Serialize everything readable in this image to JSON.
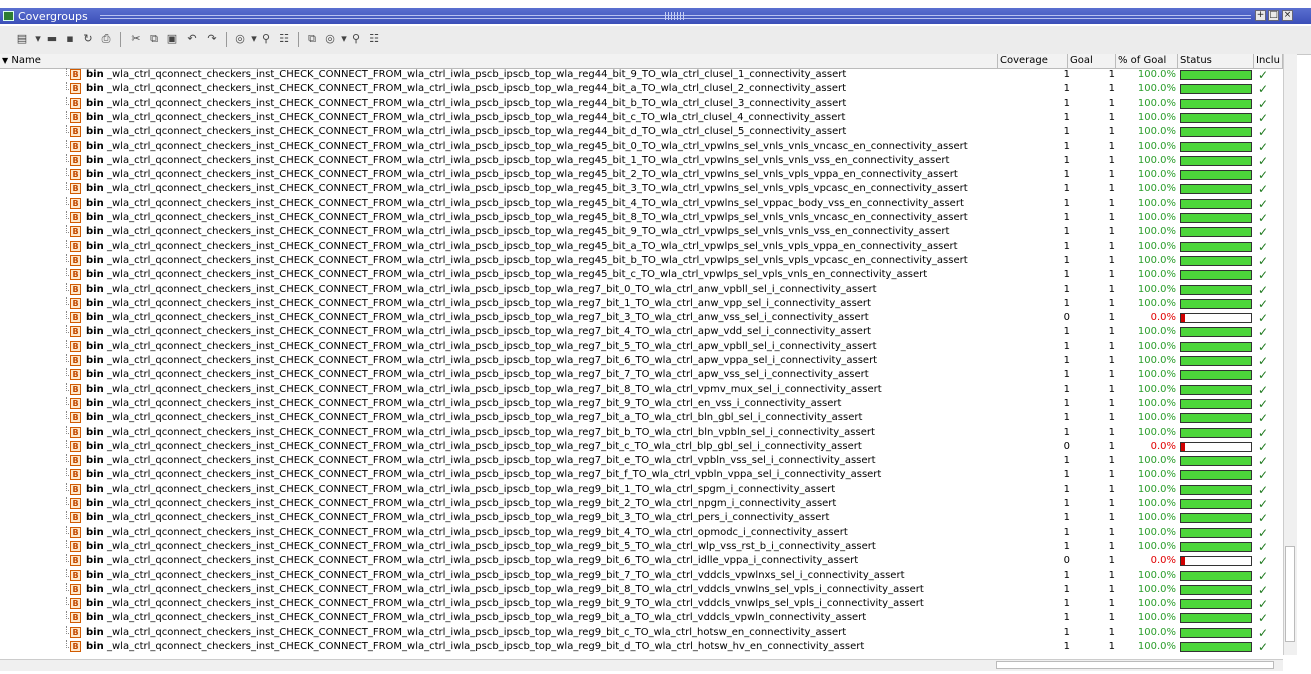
{
  "window": {
    "title": "Covergroups"
  },
  "columns": {
    "name": "Name",
    "coverage": "Coverage",
    "goal": "Goal",
    "pct_goal": "% of Goal",
    "status": "Status",
    "included": "Inclu"
  },
  "rows": [
    {
      "type": "bin",
      "name": "_wla_ctrl_qconnect_checkers_inst_CHECK_CONNECT_FROM_wla_ctrl_iwla_pscb_ipscb_top_wla_reg44_bit_9_TO_wla_ctrl_clusel_1_connectivity_assert",
      "coverage": "1",
      "goal": "1",
      "pct": "100.0%",
      "fill": 1
    },
    {
      "type": "bin",
      "name": "_wla_ctrl_qconnect_checkers_inst_CHECK_CONNECT_FROM_wla_ctrl_iwla_pscb_ipscb_top_wla_reg44_bit_a_TO_wla_ctrl_clusel_2_connectivity_assert",
      "coverage": "1",
      "goal": "1",
      "pct": "100.0%",
      "fill": 1
    },
    {
      "type": "bin",
      "name": "_wla_ctrl_qconnect_checkers_inst_CHECK_CONNECT_FROM_wla_ctrl_iwla_pscb_ipscb_top_wla_reg44_bit_b_TO_wla_ctrl_clusel_3_connectivity_assert",
      "coverage": "1",
      "goal": "1",
      "pct": "100.0%",
      "fill": 1
    },
    {
      "type": "bin",
      "name": "_wla_ctrl_qconnect_checkers_inst_CHECK_CONNECT_FROM_wla_ctrl_iwla_pscb_ipscb_top_wla_reg44_bit_c_TO_wla_ctrl_clusel_4_connectivity_assert",
      "coverage": "1",
      "goal": "1",
      "pct": "100.0%",
      "fill": 1
    },
    {
      "type": "bin",
      "name": "_wla_ctrl_qconnect_checkers_inst_CHECK_CONNECT_FROM_wla_ctrl_iwla_pscb_ipscb_top_wla_reg44_bit_d_TO_wla_ctrl_clusel_5_connectivity_assert",
      "coverage": "1",
      "goal": "1",
      "pct": "100.0%",
      "fill": 1
    },
    {
      "type": "bin",
      "name": "_wla_ctrl_qconnect_checkers_inst_CHECK_CONNECT_FROM_wla_ctrl_iwla_pscb_ipscb_top_wla_reg45_bit_0_TO_wla_ctrl_vpwlns_sel_vnls_vnls_vncasc_en_connectivity_assert",
      "coverage": "1",
      "goal": "1",
      "pct": "100.0%",
      "fill": 1
    },
    {
      "type": "bin",
      "name": "_wla_ctrl_qconnect_checkers_inst_CHECK_CONNECT_FROM_wla_ctrl_iwla_pscb_ipscb_top_wla_reg45_bit_1_TO_wla_ctrl_vpwlns_sel_vnls_vnls_vss_en_connectivity_assert",
      "coverage": "1",
      "goal": "1",
      "pct": "100.0%",
      "fill": 1
    },
    {
      "type": "bin",
      "name": "_wla_ctrl_qconnect_checkers_inst_CHECK_CONNECT_FROM_wla_ctrl_iwla_pscb_ipscb_top_wla_reg45_bit_2_TO_wla_ctrl_vpwlns_sel_vnls_vpls_vppa_en_connectivity_assert",
      "coverage": "1",
      "goal": "1",
      "pct": "100.0%",
      "fill": 1
    },
    {
      "type": "bin",
      "name": "_wla_ctrl_qconnect_checkers_inst_CHECK_CONNECT_FROM_wla_ctrl_iwla_pscb_ipscb_top_wla_reg45_bit_3_TO_wla_ctrl_vpwlns_sel_vnls_vpls_vpcasc_en_connectivity_assert",
      "coverage": "1",
      "goal": "1",
      "pct": "100.0%",
      "fill": 1
    },
    {
      "type": "bin",
      "name": "_wla_ctrl_qconnect_checkers_inst_CHECK_CONNECT_FROM_wla_ctrl_iwla_pscb_ipscb_top_wla_reg45_bit_4_TO_wla_ctrl_vpwlns_sel_vppac_body_vss_en_connectivity_assert",
      "coverage": "1",
      "goal": "1",
      "pct": "100.0%",
      "fill": 1
    },
    {
      "type": "bin",
      "name": "_wla_ctrl_qconnect_checkers_inst_CHECK_CONNECT_FROM_wla_ctrl_iwla_pscb_ipscb_top_wla_reg45_bit_8_TO_wla_ctrl_vpwlps_sel_vnls_vnls_vncasc_en_connectivity_assert",
      "coverage": "1",
      "goal": "1",
      "pct": "100.0%",
      "fill": 1
    },
    {
      "type": "bin",
      "name": "_wla_ctrl_qconnect_checkers_inst_CHECK_CONNECT_FROM_wla_ctrl_iwla_pscb_ipscb_top_wla_reg45_bit_9_TO_wla_ctrl_vpwlps_sel_vnls_vnls_vss_en_connectivity_assert",
      "coverage": "1",
      "goal": "1",
      "pct": "100.0%",
      "fill": 1
    },
    {
      "type": "bin",
      "name": "_wla_ctrl_qconnect_checkers_inst_CHECK_CONNECT_FROM_wla_ctrl_iwla_pscb_ipscb_top_wla_reg45_bit_a_TO_wla_ctrl_vpwlps_sel_vnls_vpls_vppa_en_connectivity_assert",
      "coverage": "1",
      "goal": "1",
      "pct": "100.0%",
      "fill": 1
    },
    {
      "type": "bin",
      "name": "_wla_ctrl_qconnect_checkers_inst_CHECK_CONNECT_FROM_wla_ctrl_iwla_pscb_ipscb_top_wla_reg45_bit_b_TO_wla_ctrl_vpwlps_sel_vnls_vpls_vpcasc_en_connectivity_assert",
      "coverage": "1",
      "goal": "1",
      "pct": "100.0%",
      "fill": 1
    },
    {
      "type": "bin",
      "name": "_wla_ctrl_qconnect_checkers_inst_CHECK_CONNECT_FROM_wla_ctrl_iwla_pscb_ipscb_top_wla_reg45_bit_c_TO_wla_ctrl_vpwlps_sel_vpls_vnls_en_connectivity_assert",
      "coverage": "1",
      "goal": "1",
      "pct": "100.0%",
      "fill": 1
    },
    {
      "type": "bin",
      "name": "_wla_ctrl_qconnect_checkers_inst_CHECK_CONNECT_FROM_wla_ctrl_iwla_pscb_ipscb_top_wla_reg7_bit_0_TO_wla_ctrl_anw_vpbll_sel_i_connectivity_assert",
      "coverage": "1",
      "goal": "1",
      "pct": "100.0%",
      "fill": 1
    },
    {
      "type": "bin",
      "name": "_wla_ctrl_qconnect_checkers_inst_CHECK_CONNECT_FROM_wla_ctrl_iwla_pscb_ipscb_top_wla_reg7_bit_1_TO_wla_ctrl_anw_vpp_sel_i_connectivity_assert",
      "coverage": "1",
      "goal": "1",
      "pct": "100.0%",
      "fill": 1
    },
    {
      "type": "bin",
      "name": "_wla_ctrl_qconnect_checkers_inst_CHECK_CONNECT_FROM_wla_ctrl_iwla_pscb_ipscb_top_wla_reg7_bit_3_TO_wla_ctrl_anw_vss_sel_i_connectivity_assert",
      "coverage": "0",
      "goal": "1",
      "pct": "0.0%",
      "fill": 0
    },
    {
      "type": "bin",
      "name": "_wla_ctrl_qconnect_checkers_inst_CHECK_CONNECT_FROM_wla_ctrl_iwla_pscb_ipscb_top_wla_reg7_bit_4_TO_wla_ctrl_apw_vdd_sel_i_connectivity_assert",
      "coverage": "1",
      "goal": "1",
      "pct": "100.0%",
      "fill": 1
    },
    {
      "type": "bin",
      "name": "_wla_ctrl_qconnect_checkers_inst_CHECK_CONNECT_FROM_wla_ctrl_iwla_pscb_ipscb_top_wla_reg7_bit_5_TO_wla_ctrl_apw_vpbll_sel_i_connectivity_assert",
      "coverage": "1",
      "goal": "1",
      "pct": "100.0%",
      "fill": 1
    },
    {
      "type": "bin",
      "name": "_wla_ctrl_qconnect_checkers_inst_CHECK_CONNECT_FROM_wla_ctrl_iwla_pscb_ipscb_top_wla_reg7_bit_6_TO_wla_ctrl_apw_vppa_sel_i_connectivity_assert",
      "coverage": "1",
      "goal": "1",
      "pct": "100.0%",
      "fill": 1
    },
    {
      "type": "bin",
      "name": "_wla_ctrl_qconnect_checkers_inst_CHECK_CONNECT_FROM_wla_ctrl_iwla_pscb_ipscb_top_wla_reg7_bit_7_TO_wla_ctrl_apw_vss_sel_i_connectivity_assert",
      "coverage": "1",
      "goal": "1",
      "pct": "100.0%",
      "fill": 1
    },
    {
      "type": "bin",
      "name": "_wla_ctrl_qconnect_checkers_inst_CHECK_CONNECT_FROM_wla_ctrl_iwla_pscb_ipscb_top_wla_reg7_bit_8_TO_wla_ctrl_vpmv_mux_sel_i_connectivity_assert",
      "coverage": "1",
      "goal": "1",
      "pct": "100.0%",
      "fill": 1
    },
    {
      "type": "bin",
      "name": "_wla_ctrl_qconnect_checkers_inst_CHECK_CONNECT_FROM_wla_ctrl_iwla_pscb_ipscb_top_wla_reg7_bit_9_TO_wla_ctrl_en_vss_i_connectivity_assert",
      "coverage": "1",
      "goal": "1",
      "pct": "100.0%",
      "fill": 1
    },
    {
      "type": "bin",
      "name": "_wla_ctrl_qconnect_checkers_inst_CHECK_CONNECT_FROM_wla_ctrl_iwla_pscb_ipscb_top_wla_reg7_bit_a_TO_wla_ctrl_bln_gbl_sel_i_connectivity_assert",
      "coverage": "1",
      "goal": "1",
      "pct": "100.0%",
      "fill": 1
    },
    {
      "type": "bin",
      "name": "_wla_ctrl_qconnect_checkers_inst_CHECK_CONNECT_FROM_wla_ctrl_iwla_pscb_ipscb_top_wla_reg7_bit_b_TO_wla_ctrl_bln_vpbln_sel_i_connectivity_assert",
      "coverage": "1",
      "goal": "1",
      "pct": "100.0%",
      "fill": 1
    },
    {
      "type": "bin",
      "name": "_wla_ctrl_qconnect_checkers_inst_CHECK_CONNECT_FROM_wla_ctrl_iwla_pscb_ipscb_top_wla_reg7_bit_c_TO_wla_ctrl_blp_gbl_sel_i_connectivity_assert",
      "coverage": "0",
      "goal": "1",
      "pct": "0.0%",
      "fill": 0
    },
    {
      "type": "bin",
      "name": "_wla_ctrl_qconnect_checkers_inst_CHECK_CONNECT_FROM_wla_ctrl_iwla_pscb_ipscb_top_wla_reg7_bit_e_TO_wla_ctrl_vpbln_vss_sel_i_connectivity_assert",
      "coverage": "1",
      "goal": "1",
      "pct": "100.0%",
      "fill": 1
    },
    {
      "type": "bin",
      "name": "_wla_ctrl_qconnect_checkers_inst_CHECK_CONNECT_FROM_wla_ctrl_iwla_pscb_ipscb_top_wla_reg7_bit_f_TO_wla_ctrl_vpbln_vppa_sel_i_connectivity_assert",
      "coverage": "1",
      "goal": "1",
      "pct": "100.0%",
      "fill": 1
    },
    {
      "type": "bin",
      "name": "_wla_ctrl_qconnect_checkers_inst_CHECK_CONNECT_FROM_wla_ctrl_iwla_pscb_ipscb_top_wla_reg9_bit_1_TO_wla_ctrl_spgm_i_connectivity_assert",
      "coverage": "1",
      "goal": "1",
      "pct": "100.0%",
      "fill": 1
    },
    {
      "type": "bin",
      "name": "_wla_ctrl_qconnect_checkers_inst_CHECK_CONNECT_FROM_wla_ctrl_iwla_pscb_ipscb_top_wla_reg9_bit_2_TO_wla_ctrl_npgm_i_connectivity_assert",
      "coverage": "1",
      "goal": "1",
      "pct": "100.0%",
      "fill": 1
    },
    {
      "type": "bin",
      "name": "_wla_ctrl_qconnect_checkers_inst_CHECK_CONNECT_FROM_wla_ctrl_iwla_pscb_ipscb_top_wla_reg9_bit_3_TO_wla_ctrl_pers_i_connectivity_assert",
      "coverage": "1",
      "goal": "1",
      "pct": "100.0%",
      "fill": 1
    },
    {
      "type": "bin",
      "name": "_wla_ctrl_qconnect_checkers_inst_CHECK_CONNECT_FROM_wla_ctrl_iwla_pscb_ipscb_top_wla_reg9_bit_4_TO_wla_ctrl_opmodc_i_connectivity_assert",
      "coverage": "1",
      "goal": "1",
      "pct": "100.0%",
      "fill": 1
    },
    {
      "type": "bin",
      "name": "_wla_ctrl_qconnect_checkers_inst_CHECK_CONNECT_FROM_wla_ctrl_iwla_pscb_ipscb_top_wla_reg9_bit_5_TO_wla_ctrl_wlp_vss_rst_b_i_connectivity_assert",
      "coverage": "1",
      "goal": "1",
      "pct": "100.0%",
      "fill": 1
    },
    {
      "type": "bin",
      "name": "_wla_ctrl_qconnect_checkers_inst_CHECK_CONNECT_FROM_wla_ctrl_iwla_pscb_ipscb_top_wla_reg9_bit_6_TO_wla_ctrl_idlle_vppa_i_connectivity_assert",
      "coverage": "0",
      "goal": "1",
      "pct": "0.0%",
      "fill": 0
    },
    {
      "type": "bin",
      "name": "_wla_ctrl_qconnect_checkers_inst_CHECK_CONNECT_FROM_wla_ctrl_iwla_pscb_ipscb_top_wla_reg9_bit_7_TO_wla_ctrl_vddcls_vpwlnxs_sel_i_connectivity_assert",
      "coverage": "1",
      "goal": "1",
      "pct": "100.0%",
      "fill": 1
    },
    {
      "type": "bin",
      "name": "_wla_ctrl_qconnect_checkers_inst_CHECK_CONNECT_FROM_wla_ctrl_iwla_pscb_ipscb_top_wla_reg9_bit_8_TO_wla_ctrl_vddcls_vnwlns_sel_vpls_i_connectivity_assert",
      "coverage": "1",
      "goal": "1",
      "pct": "100.0%",
      "fill": 1
    },
    {
      "type": "bin",
      "name": "_wla_ctrl_qconnect_checkers_inst_CHECK_CONNECT_FROM_wla_ctrl_iwla_pscb_ipscb_top_wla_reg9_bit_9_TO_wla_ctrl_vddcls_vnwlps_sel_vpls_i_connectivity_assert",
      "coverage": "1",
      "goal": "1",
      "pct": "100.0%",
      "fill": 1
    },
    {
      "type": "bin",
      "name": "_wla_ctrl_qconnect_checkers_inst_CHECK_CONNECT_FROM_wla_ctrl_iwla_pscb_ipscb_top_wla_reg9_bit_a_TO_wla_ctrl_vddcls_vpwln_connectivity_assert",
      "coverage": "1",
      "goal": "1",
      "pct": "100.0%",
      "fill": 1
    },
    {
      "type": "bin",
      "name": "_wla_ctrl_qconnect_checkers_inst_CHECK_CONNECT_FROM_wla_ctrl_iwla_pscb_ipscb_top_wla_reg9_bit_c_TO_wla_ctrl_hotsw_en_connectivity_assert",
      "coverage": "1",
      "goal": "1",
      "pct": "100.0%",
      "fill": 1
    },
    {
      "type": "bin",
      "name": "_wla_ctrl_qconnect_checkers_inst_CHECK_CONNECT_FROM_wla_ctrl_iwla_pscb_ipscb_top_wla_reg9_bit_d_TO_wla_ctrl_hotsw_hv_en_connectivity_assert",
      "coverage": "1",
      "goal": "1",
      "pct": "100.0%",
      "fill": 1
    }
  ],
  "icons": {
    "bin_badge": "B",
    "included_mark": "✓",
    "sort_arrow": "▼"
  },
  "colors": {
    "title_bg": "#3b4fb8",
    "pct_ok": "#2a9d2a",
    "pct_bad": "#e00000",
    "bar_ok": "#4cd63a",
    "bar_bad": "#d00000"
  }
}
